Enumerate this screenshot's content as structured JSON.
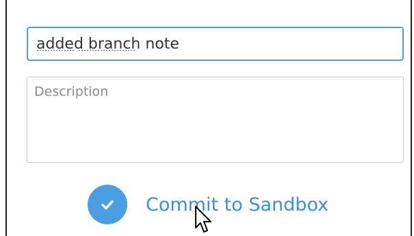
{
  "form": {
    "summary_value": "added branch note",
    "description_placeholder": "Description",
    "description_value": "",
    "commit_label": "Commit to Sandbox"
  },
  "icons": {
    "commit": "checkmark-icon",
    "pointer": "mouse-cursor-icon"
  },
  "colors": {
    "accent": "#4a9fe3",
    "commit_text": "#3c8fd8",
    "focus_border": "#5b9bd5",
    "spellcheck": "#d32f2f"
  }
}
